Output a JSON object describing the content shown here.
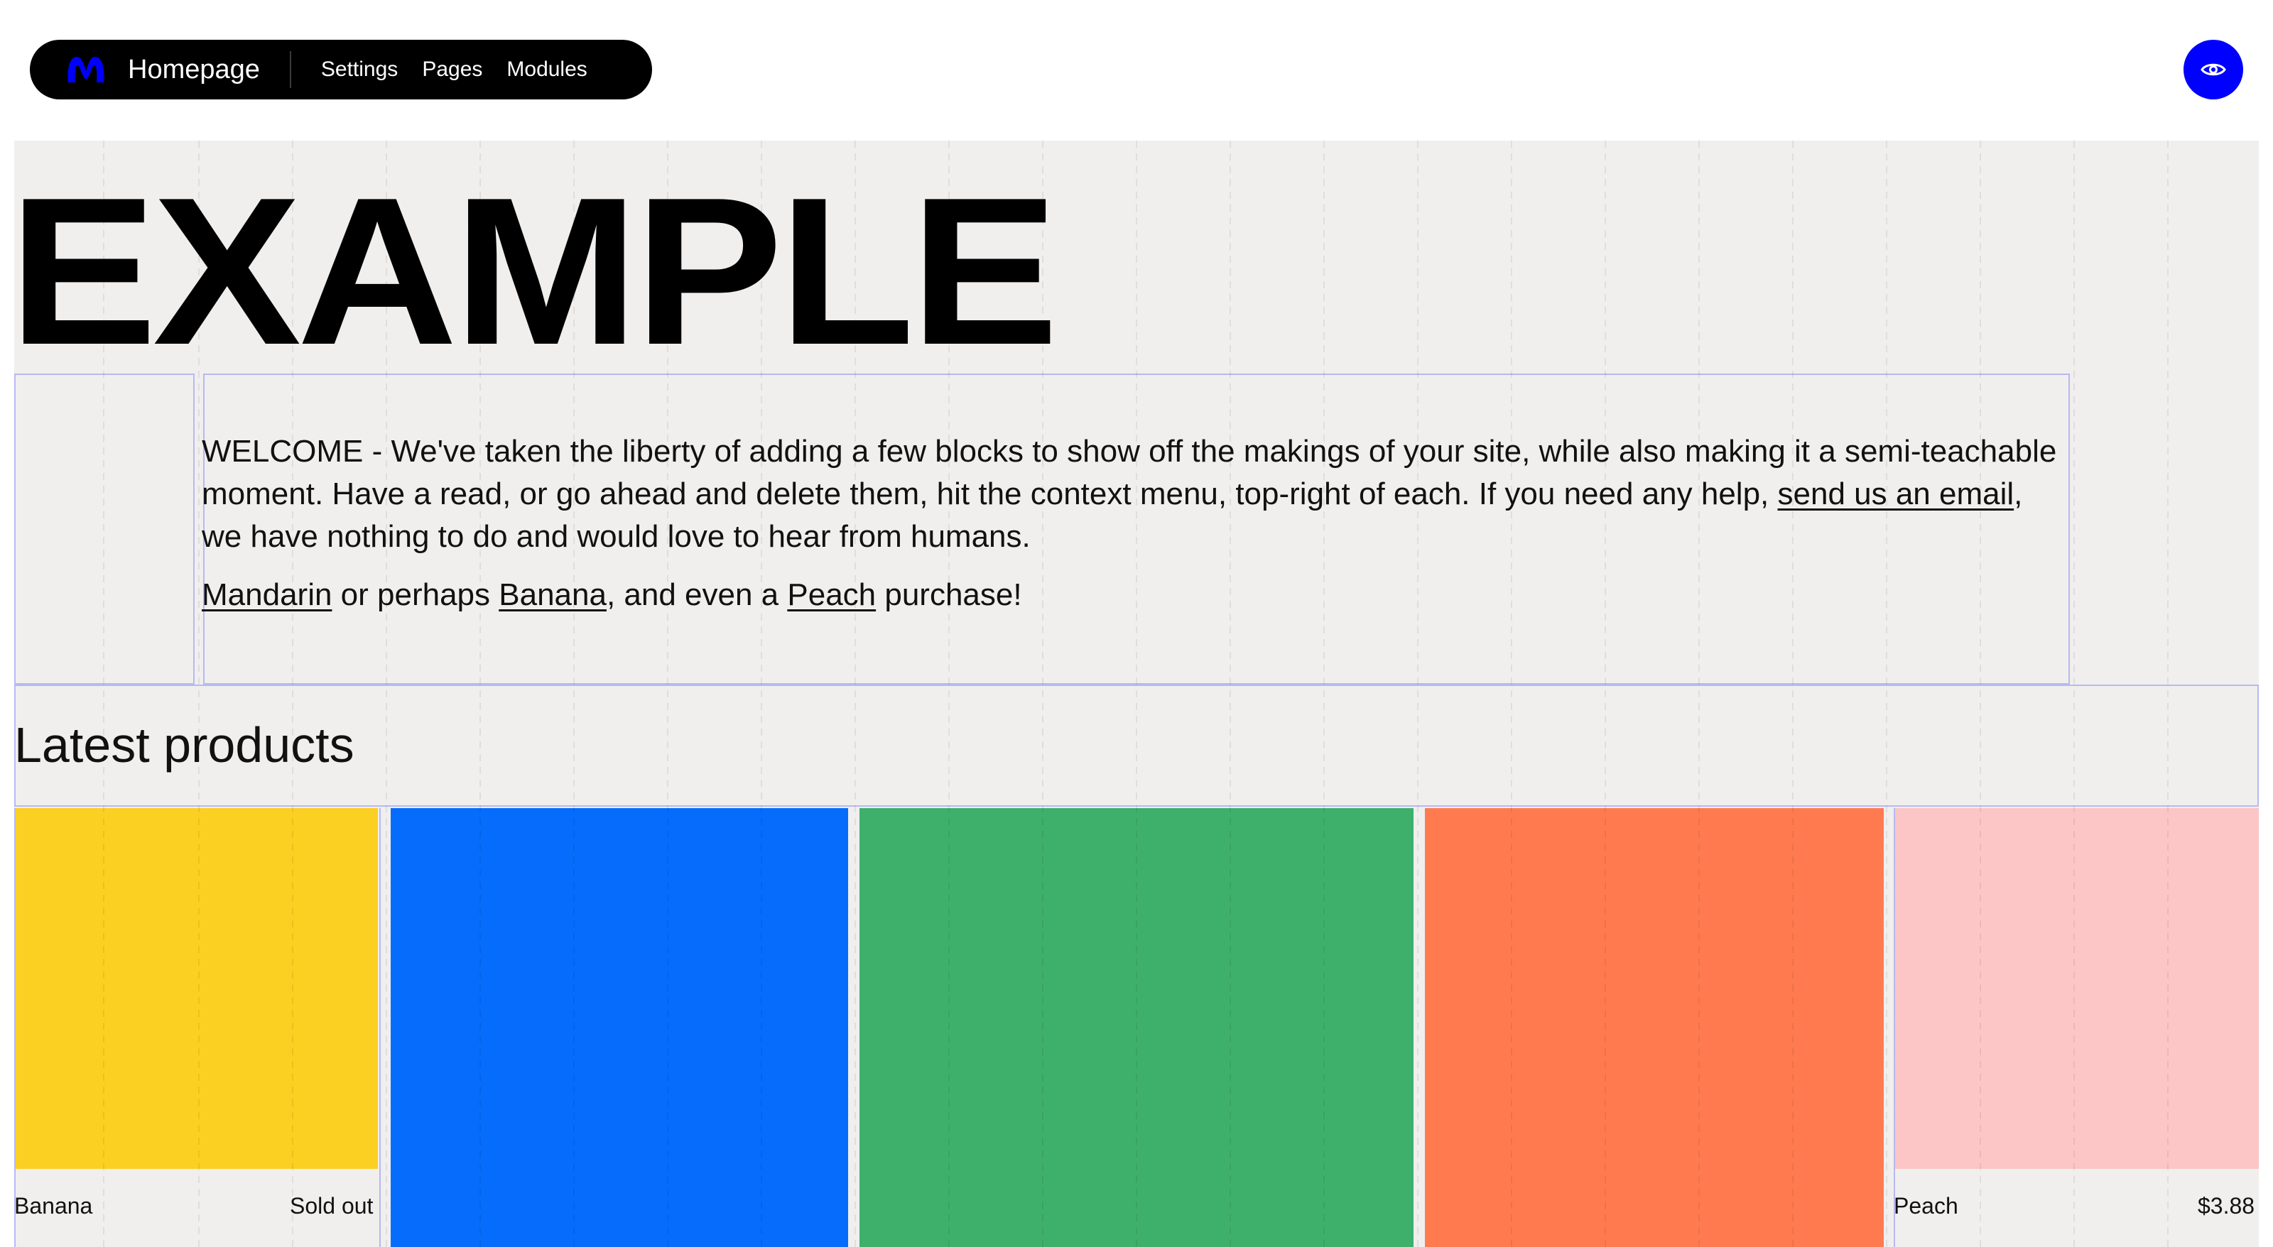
{
  "nav": {
    "site_title": "Homepage",
    "links": [
      "Settings",
      "Pages",
      "Modules"
    ]
  },
  "hero": {
    "title": "EXAMPLE"
  },
  "welcome": {
    "text_before_link": "WELCOME - We've taken the liberty of adding a few blocks to show off the makings of your site, while also making it a semi-teachable moment. Have a read, or go ahead and delete them, hit the context menu, top-right of each. If you need any help, ",
    "email_link": "send us an email",
    "text_after_link": ", we have nothing to do and would love to hear from humans."
  },
  "purchase": {
    "link_1": "Mandarin",
    "text_1": " or perhaps ",
    "link_2": "Banana",
    "text_2": ", and even a ",
    "link_3": "Peach",
    "text_3": " purchase!"
  },
  "products_section": {
    "title": "Latest products"
  },
  "products": [
    {
      "name": "Banana",
      "price": "Sold out",
      "color": "#fcd022"
    },
    {
      "name": "",
      "price": "",
      "color": "#056cfc"
    },
    {
      "name": "",
      "price": "",
      "color": "#3fb06b"
    },
    {
      "name": "",
      "price": "",
      "color": "#ff7b4f"
    },
    {
      "name": "Peach",
      "price": "$3.88",
      "color": "#fcc6c6"
    }
  ],
  "colors": {
    "accent_blue": "#0000ff",
    "canvas_bg": "#f0efed",
    "block_outline": "#b6b9f2"
  },
  "icons": {
    "logo": "brand-logo-icon",
    "preview": "eye-icon"
  }
}
